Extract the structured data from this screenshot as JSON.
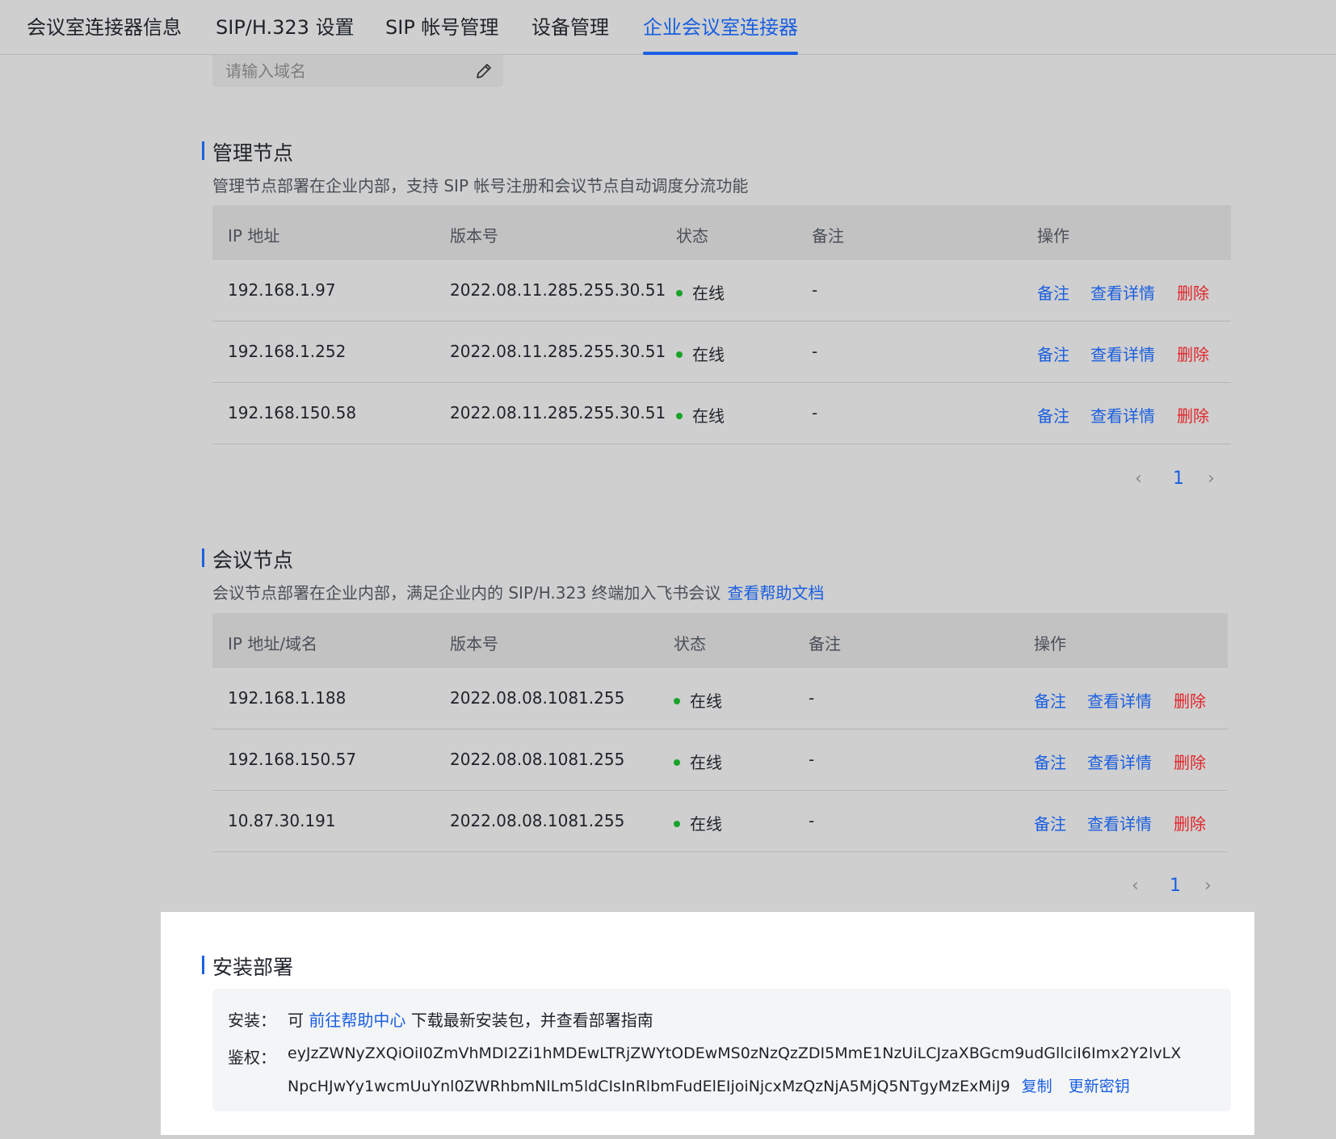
{
  "tabs": [
    {
      "label": "会议室连接器信息"
    },
    {
      "label": "SIP/H.323 设置"
    },
    {
      "label": "SIP 帐号管理"
    },
    {
      "label": "设备管理"
    },
    {
      "label": "企业会议室连接器"
    }
  ],
  "domain": {
    "placeholder": "请输入域名"
  },
  "mgmt": {
    "title": "管理节点",
    "desc": "管理节点部署在企业内部，支持 SIP 帐号注册和会议节点自动调度分流功能",
    "headers": [
      "IP 地址",
      "版本号",
      "状态",
      "备注",
      "操作"
    ],
    "rows": [
      {
        "ip": "192.168.1.97",
        "version": "2022.08.11.285.255.30.51",
        "status": "在线",
        "note": "-"
      },
      {
        "ip": "192.168.1.252",
        "version": "2022.08.11.285.255.30.51",
        "status": "在线",
        "note": "-"
      },
      {
        "ip": "192.168.150.58",
        "version": "2022.08.11.285.255.30.51",
        "status": "在线",
        "note": "-"
      }
    ],
    "page": "1"
  },
  "meeting": {
    "title": "会议节点",
    "desc": "会议节点部署在企业内部，满足企业内的 SIP/H.323 终端加入飞书会议",
    "help_link": "查看帮助文档",
    "headers": [
      "IP 地址/域名",
      "版本号",
      "状态",
      "备注",
      "操作"
    ],
    "rows": [
      {
        "ip": "192.168.1.188",
        "version": "2022.08.08.1081.255",
        "status": "在线",
        "note": "-"
      },
      {
        "ip": "192.168.150.57",
        "version": "2022.08.08.1081.255",
        "status": "在线",
        "note": "-"
      },
      {
        "ip": "10.87.30.191",
        "version": "2022.08.08.1081.255",
        "status": "在线",
        "note": "-"
      }
    ],
    "page": "1"
  },
  "actions": {
    "note": "备注",
    "detail": "查看详情",
    "delete": "删除"
  },
  "install": {
    "title": "安装部署",
    "install_label": "安装：",
    "install_prefix": "可",
    "install_link": "前往帮助中心",
    "install_suffix": "下载最新安装包，并查看部署指南",
    "auth_label": "鉴权：",
    "token_line1": "eyJzZWNyZXQiOiI0ZmVhMDI2Zi1hMDEwLTRjZWYtODEwMS0zNzQzZDI5MmE1NzUiLCJzaXBGcm9udGllciI6Imx2Y2lvLX",
    "token_line2": "NpcHJwYy1wcmUuYnl0ZWRhbmNlLm5ldCIsInRlbmFudElEIjoiNjcxMzQzNjA5MjQ5NTgyMzExMiJ9",
    "copy": "复制",
    "renew": "更新密钥"
  },
  "colors": {
    "accent": "#1a5fe0",
    "danger": "#e0262b",
    "online": "#18a32a"
  }
}
